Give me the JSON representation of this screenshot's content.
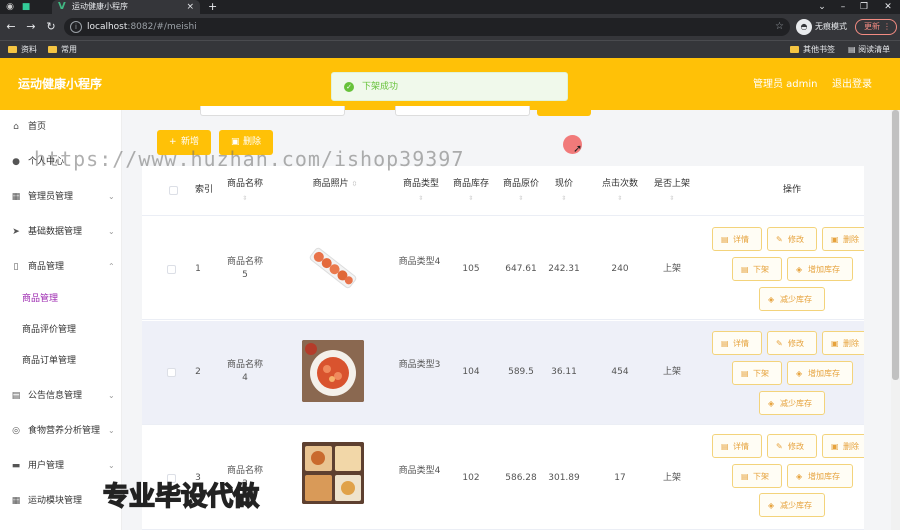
{
  "browser": {
    "active_tab_title": "运动健康小程序",
    "url_host": "localhost",
    "url_path": ":8082/#/meishi",
    "incognito_label": "无痕模式",
    "update_label": "更新",
    "bookmarks": [
      "资料",
      "常用"
    ],
    "other_bookmarks": "其他书签",
    "reading_list": "阅读清单"
  },
  "header": {
    "app_title": "运动健康小程序",
    "user_label": "管理员 admin",
    "logout_label": "退出登录"
  },
  "toast": {
    "message": "下架成功",
    "accent": "#67c23a"
  },
  "sidebar": {
    "items": [
      {
        "label": "首页",
        "icon": "home-icon"
      },
      {
        "label": "个人中心",
        "icon": "user-icon"
      },
      {
        "label": "管理员管理",
        "icon": "grid-icon"
      },
      {
        "label": "基础数据管理",
        "icon": "send-icon"
      },
      {
        "label": "商品管理",
        "icon": "phone-icon"
      }
    ],
    "sub_items": [
      "商品管理",
      "商品评价管理",
      "商品订单管理"
    ],
    "items_after": [
      {
        "label": "公告信息管理",
        "icon": "list-icon"
      },
      {
        "label": "食物营养分析管理",
        "icon": "compass-icon"
      },
      {
        "label": "用户管理",
        "icon": "chat-icon"
      },
      {
        "label": "运动模块管理",
        "icon": "grid-icon"
      }
    ]
  },
  "actions": {
    "add_label": "新增",
    "delete_label": "删除"
  },
  "table": {
    "headers": {
      "index": "索引",
      "name": "商品名称",
      "image": "商品照片",
      "type": "商品类型",
      "stock": "商品库存",
      "original_price": "商品原价",
      "current_price": "现价",
      "clicks": "点击次数",
      "listed": "是否上架",
      "ops": "操作"
    },
    "op_labels": {
      "detail": "详情",
      "edit": "修改",
      "delete": "删除",
      "delist": "下架",
      "add_stock": "增加库存",
      "reduce_stock": "减少库存"
    },
    "rows": [
      {
        "index": "1",
        "name": "商品名称5",
        "type": "商品类型4",
        "stock": "105",
        "original_price": "647.61",
        "current_price": "242.31",
        "clicks": "240",
        "listed": "上架"
      },
      {
        "index": "2",
        "name": "商品名称4",
        "type": "商品类型3",
        "stock": "104",
        "original_price": "589.5",
        "current_price": "36.11",
        "clicks": "454",
        "listed": "上架"
      },
      {
        "index": "3",
        "name": "商品名称3",
        "type": "商品类型4",
        "stock": "102",
        "original_price": "586.28",
        "current_price": "301.89",
        "clicks": "17",
        "listed": "上架"
      }
    ]
  },
  "overlay": {
    "watermark": "https://www.huzhan.com/ishop39397",
    "promo": "专业毕设代做"
  },
  "colors": {
    "brand": "#ffc107",
    "active_menu": "#9c27b0",
    "op_text": "#e6a23c"
  }
}
